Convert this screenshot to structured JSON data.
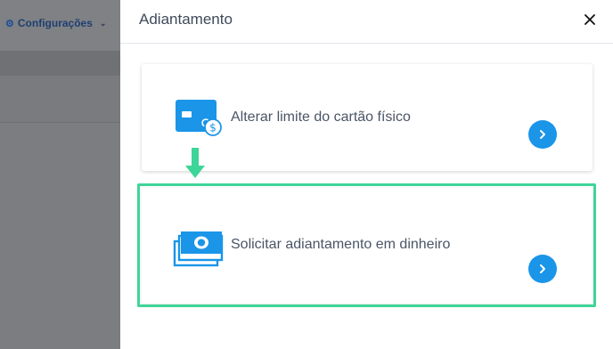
{
  "background_app": {
    "config_label": "Configurações"
  },
  "drawer": {
    "title": "Adiantamento",
    "close_symbol": "✕",
    "options": [
      {
        "label": "Alterar limite do cartão físico",
        "icon": "card-limit-icon"
      },
      {
        "label": "Solicitar adiantamento em dinheiro",
        "icon": "cash-icon"
      }
    ]
  },
  "colors": {
    "accent_blue": "#1a95e8",
    "highlight_green": "#3ed598",
    "overlay_gray": "#7b7d80"
  }
}
